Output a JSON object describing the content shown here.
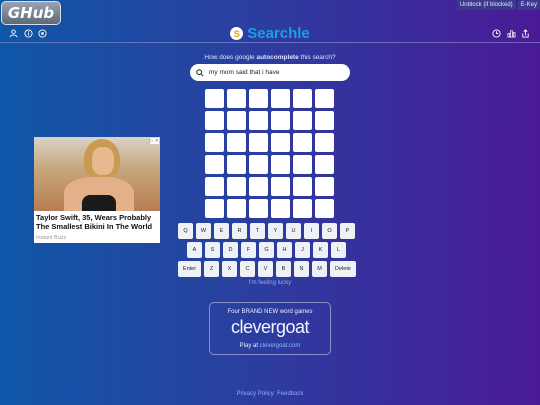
{
  "header": {
    "ghub_logo": "GHub",
    "unblock_link": "Unblock (if blocked)",
    "ekey_link": "E-Key",
    "icons_left": [
      "user-icon",
      "info-icon",
      "settings-icon"
    ],
    "icons_right": [
      "history-icon",
      "stats-icon",
      "share-icon"
    ],
    "brand": {
      "badge": "S",
      "title": "Searchle"
    }
  },
  "game": {
    "question_prefix": "How does google ",
    "question_bold": "autocomplete",
    "question_suffix": " this search?",
    "search_query": "my mom said that i have"
  },
  "keyboard": {
    "row1": [
      "Q",
      "W",
      "E",
      "R",
      "T",
      "Y",
      "U",
      "I",
      "O",
      "P"
    ],
    "row2": [
      "A",
      "S",
      "D",
      "F",
      "G",
      "H",
      "J",
      "K",
      "L"
    ],
    "row3": [
      "Enter",
      "Z",
      "X",
      "C",
      "V",
      "B",
      "N",
      "M",
      "Delete"
    ]
  },
  "lucky": "I'm feeling lucky",
  "ad": {
    "headline": "Taylor Swift, 35, Wears Probably The Smallest Bikini In The World",
    "source": "Instant Buzz"
  },
  "promo": {
    "line1": "Four BRAND NEW word games",
    "brand": "clevergoat",
    "line3_prefix": "Play at ",
    "line3_link": "clevergoat.com"
  },
  "footer": {
    "privacy": "Privacy Policy",
    "feedback": "Feedback"
  }
}
